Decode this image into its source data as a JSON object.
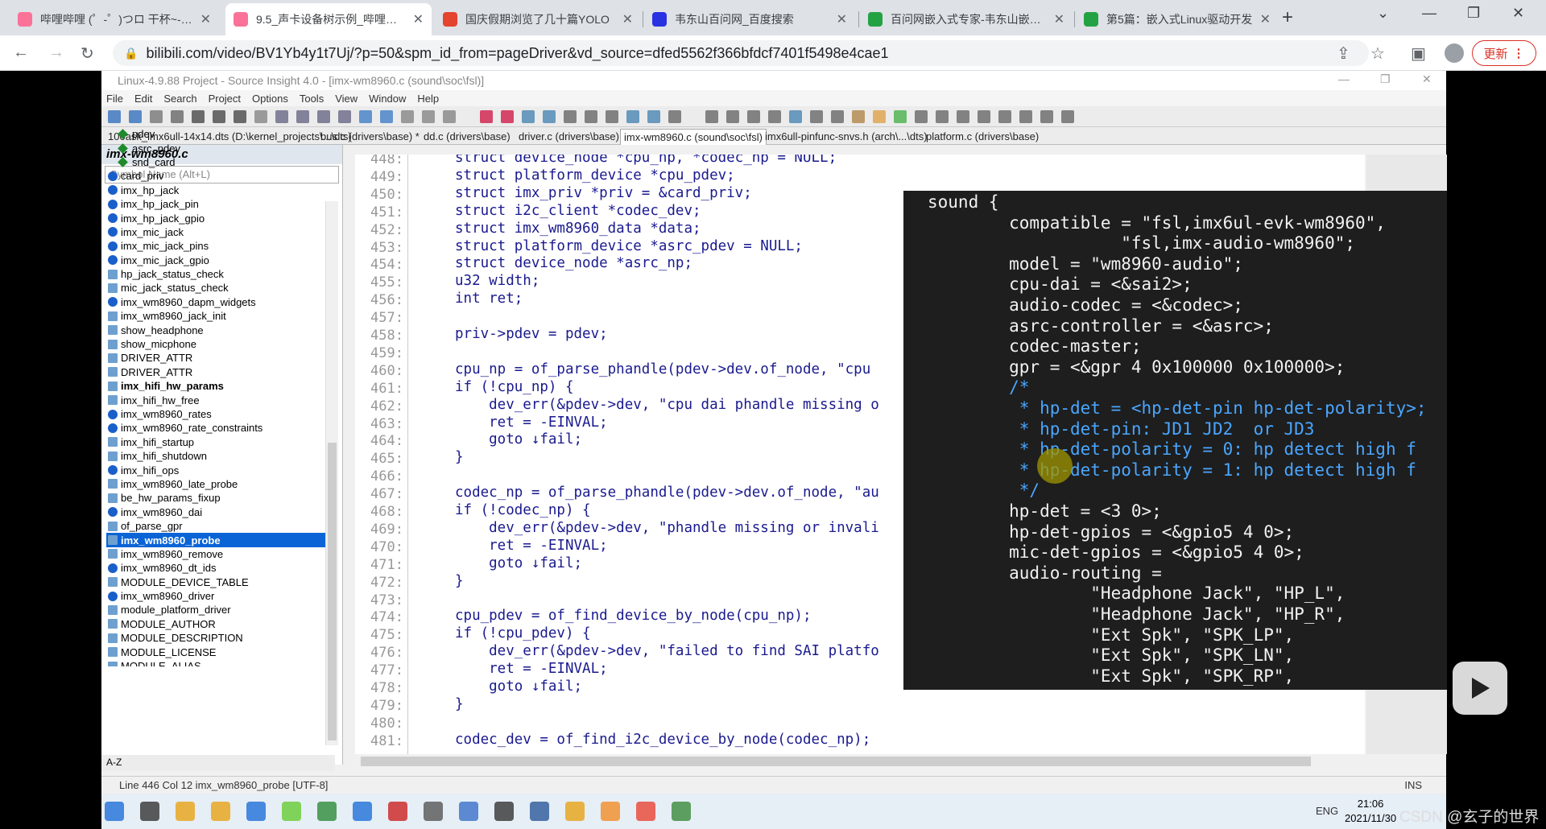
{
  "browser": {
    "tabs": [
      {
        "title": "哔哩哔哩 (゜-゜)つロ 干杯~-bilibili",
        "color": "#fb7299",
        "icon": "bilibili-icon"
      },
      {
        "title": "9.5_声卡设备树示例_哔哩哔哩_bilibili",
        "color": "#fb7299",
        "icon": "bilibili-icon",
        "active": true
      },
      {
        "title": "国庆假期浏览了几十篇YOLO",
        "color": "#e3432f",
        "icon": "csdn-icon"
      },
      {
        "title": "韦东山百问网_百度搜索",
        "color": "#2932e1",
        "icon": "baidu-icon"
      },
      {
        "title": "百问网嵌入式专家-韦东山嵌入式",
        "color": "#23a244",
        "icon": "site-icon"
      },
      {
        "title": "第5篇：嵌入式Linux驱动开发",
        "color": "#23a244",
        "icon": "site-icon"
      }
    ],
    "new_tab": "+",
    "url": "bilibili.com/video/BV1Yb4y1t7Uj/?p=50&spm_id_from=pageDriver&vd_source=dfed5562f366bfdcf7401f5498e4cae1",
    "update_label": "更新"
  },
  "si": {
    "window_title": "Linux-4.9.88 Project - Source Insight 4.0 - [imx-wm8960.c (sound\\soc\\fsl)]",
    "menu": [
      "File",
      "Edit",
      "Search",
      "Project",
      "Options",
      "Tools",
      "View",
      "Window",
      "Help"
    ],
    "file_tabs": [
      "100ask_imx6ull-14x14.dts (D:\\kernel_projects\\...\\dts)",
      "bus.c (drivers\\base) *",
      "dd.c (drivers\\base)",
      "driver.c (drivers\\base)",
      "imx-wm8960.c (sound\\soc\\fsl)",
      "imx6ull-pinfunc-snvs.h (arch\\...\\dts)",
      "platform.c (drivers\\base)"
    ],
    "panel_title": "imx-wm8960.c",
    "symbol_placeholder": "Symbol Name (Alt+L)",
    "symbols": [
      {
        "name": "pdev",
        "type": "member"
      },
      {
        "name": "asrc_pdev",
        "type": "member"
      },
      {
        "name": "snd_card",
        "type": "member"
      },
      {
        "name": "card_priv",
        "type": "var"
      },
      {
        "name": "imx_hp_jack",
        "type": "var"
      },
      {
        "name": "imx_hp_jack_pin",
        "type": "var"
      },
      {
        "name": "imx_hp_jack_gpio",
        "type": "var"
      },
      {
        "name": "imx_mic_jack",
        "type": "var"
      },
      {
        "name": "imx_mic_jack_pins",
        "type": "var"
      },
      {
        "name": "imx_mic_jack_gpio",
        "type": "var"
      },
      {
        "name": "hp_jack_status_check",
        "type": "func"
      },
      {
        "name": "mic_jack_status_check",
        "type": "func"
      },
      {
        "name": "imx_wm8960_dapm_widgets",
        "type": "var"
      },
      {
        "name": "imx_wm8960_jack_init",
        "type": "func"
      },
      {
        "name": "show_headphone",
        "type": "func"
      },
      {
        "name": "show_micphone",
        "type": "func"
      },
      {
        "name": "DRIVER_ATTR",
        "type": "macro"
      },
      {
        "name": "DRIVER_ATTR",
        "type": "macro"
      },
      {
        "name": "imx_hifi_hw_params",
        "type": "func",
        "bold": true
      },
      {
        "name": "imx_hifi_hw_free",
        "type": "func"
      },
      {
        "name": "imx_wm8960_rates",
        "type": "var"
      },
      {
        "name": "imx_wm8960_rate_constraints",
        "type": "var"
      },
      {
        "name": "imx_hifi_startup",
        "type": "func"
      },
      {
        "name": "imx_hifi_shutdown",
        "type": "func"
      },
      {
        "name": "imx_hifi_ops",
        "type": "var"
      },
      {
        "name": "imx_wm8960_late_probe",
        "type": "func"
      },
      {
        "name": "be_hw_params_fixup",
        "type": "func"
      },
      {
        "name": "imx_wm8960_dai",
        "type": "var"
      },
      {
        "name": "of_parse_gpr",
        "type": "func"
      },
      {
        "name": "imx_wm8960_probe",
        "type": "func",
        "selected": true
      },
      {
        "name": "imx_wm8960_remove",
        "type": "func"
      },
      {
        "name": "imx_wm8960_dt_ids",
        "type": "var"
      },
      {
        "name": "MODULE_DEVICE_TABLE",
        "type": "macro"
      },
      {
        "name": "imx_wm8960_driver",
        "type": "var"
      },
      {
        "name": "module_platform_driver",
        "type": "macro"
      },
      {
        "name": "MODULE_AUTHOR",
        "type": "macro"
      },
      {
        "name": "MODULE_DESCRIPTION",
        "type": "macro"
      },
      {
        "name": "MODULE_LICENSE",
        "type": "macro"
      },
      {
        "name": "MODULE_ALIAS",
        "type": "macro"
      }
    ],
    "panel_bottom": "A-Z",
    "line_numbers": [
      "448:",
      "449:",
      "450:",
      "451:",
      "452:",
      "453:",
      "454:",
      "455:",
      "456:",
      "457:",
      "458:",
      "459:",
      "460:",
      "461:",
      "462:",
      "463:",
      "464:",
      "465:",
      "466:",
      "467:",
      "468:",
      "469:",
      "470:",
      "471:",
      "472:",
      "473:",
      "474:",
      "475:",
      "476:",
      "477:",
      "478:",
      "479:",
      "480:",
      "481:"
    ],
    "code_lines": [
      "struct device_node *cpu_np, *codec_np = NULL;",
      "struct platform_device *cpu_pdev;",
      "struct imx_priv *priv = &card_priv;",
      "struct i2c_client *codec_dev;",
      "struct imx_wm8960_data *data;",
      "struct platform_device *asrc_pdev = NULL;",
      "struct device_node *asrc_np;",
      "u32 width;",
      "int ret;",
      "",
      "priv->pdev = pdev;",
      "",
      "cpu_np = of_parse_phandle(pdev->dev.of_node, \"cpu",
      "if (!cpu_np) {",
      "    dev_err(&pdev->dev, \"cpu dai phandle missing o",
      "    ret = -EINVAL;",
      "    goto ↓fail;",
      "}",
      "",
      "codec_np = of_parse_phandle(pdev->dev.of_node, \"au",
      "if (!codec_np) {",
      "    dev_err(&pdev->dev, \"phandle missing or invali",
      "    ret = -EINVAL;",
      "    goto ↓fail;",
      "}",
      "",
      "cpu_pdev = of_find_device_by_node(cpu_np);",
      "if (!cpu_pdev) {",
      "    dev_err(&pdev->dev, \"failed to find SAI platfo",
      "    ret = -EINVAL;",
      "    goto ↓fail;",
      "}",
      "",
      "codec_dev = of_find_i2c_device_by_node(codec_np);"
    ],
    "status_text": "Line 446  Col 12   imx_wm8960_probe [UTF-8]",
    "status_mode": "INS"
  },
  "terminal": {
    "lines": [
      "sound {",
      "        compatible = \"fsl,imx6ul-evk-wm8960\",",
      "                   \"fsl,imx-audio-wm8960\";",
      "        model = \"wm8960-audio\";",
      "        cpu-dai = <&sai2>;",
      "        audio-codec = <&codec>;",
      "        asrc-controller = <&asrc>;",
      "        codec-master;",
      "        gpr = <&gpr 4 0x100000 0x100000>;",
      "        /*",
      "         * hp-det = <hp-det-pin hp-det-polarity>;",
      "         * hp-det-pin: JD1 JD2  or JD3",
      "         * hp-det-polarity = 0: hp detect high f",
      "         * hp-det-polarity = 1: hp detect high f",
      "         */",
      "        hp-det = <3 0>;",
      "        hp-det-gpios = <&gpio5 4 0>;",
      "        mic-det-gpios = <&gpio5 4 0>;",
      "        audio-routing =",
      "                \"Headphone Jack\", \"HP_L\",",
      "                \"Headphone Jack\", \"HP_R\",",
      "                \"Ext Spk\", \"SPK_LP\",",
      "                \"Ext Spk\", \"SPK_LN\",",
      "                \"Ext Spk\", \"SPK_RP\","
    ]
  },
  "taskbar": {
    "tray_lang": "ENG",
    "time": "21:06",
    "date": "2021/11/30"
  },
  "watermark": "CSDN @玄子的世界"
}
